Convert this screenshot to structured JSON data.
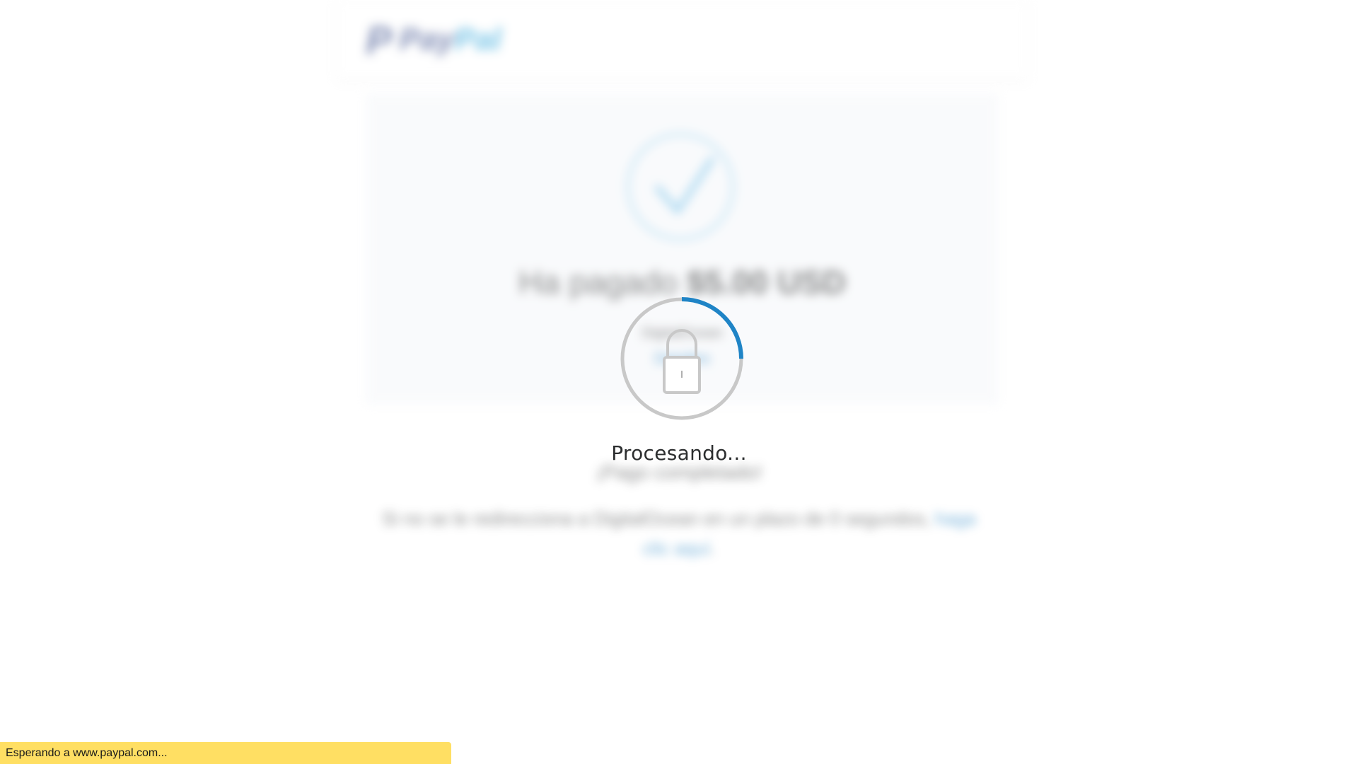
{
  "background": {
    "logo": {
      "mark": "P",
      "word_part1": "Pay",
      "word_part2": "Pal",
      "icon": "paypal-logo-icon"
    },
    "card": {
      "icon": "checkmark-circle-icon",
      "paid_prefix": "Ha pagado",
      "paid_amount": "$5.00 USD",
      "merchant": "DigitalOcean",
      "details_link": "Detalles"
    },
    "completed_text": "¡Pago completado!",
    "redirect_text": "Si no se le redirecciona a DigitalOcean en un plazo de 0 segundos,",
    "redirect_link": "haga clic aquí",
    "redirect_end": "."
  },
  "overlay": {
    "spinner_icon": "lock-spinner-icon",
    "processing_text": "Procesando..."
  },
  "status_bar": {
    "text": "Esperando a www.paypal.com..."
  },
  "colors": {
    "accent_blue": "#1f84c6",
    "status_bar": "#ffdf63",
    "paypal_dark": "#253b80",
    "paypal_light": "#179bd7"
  }
}
